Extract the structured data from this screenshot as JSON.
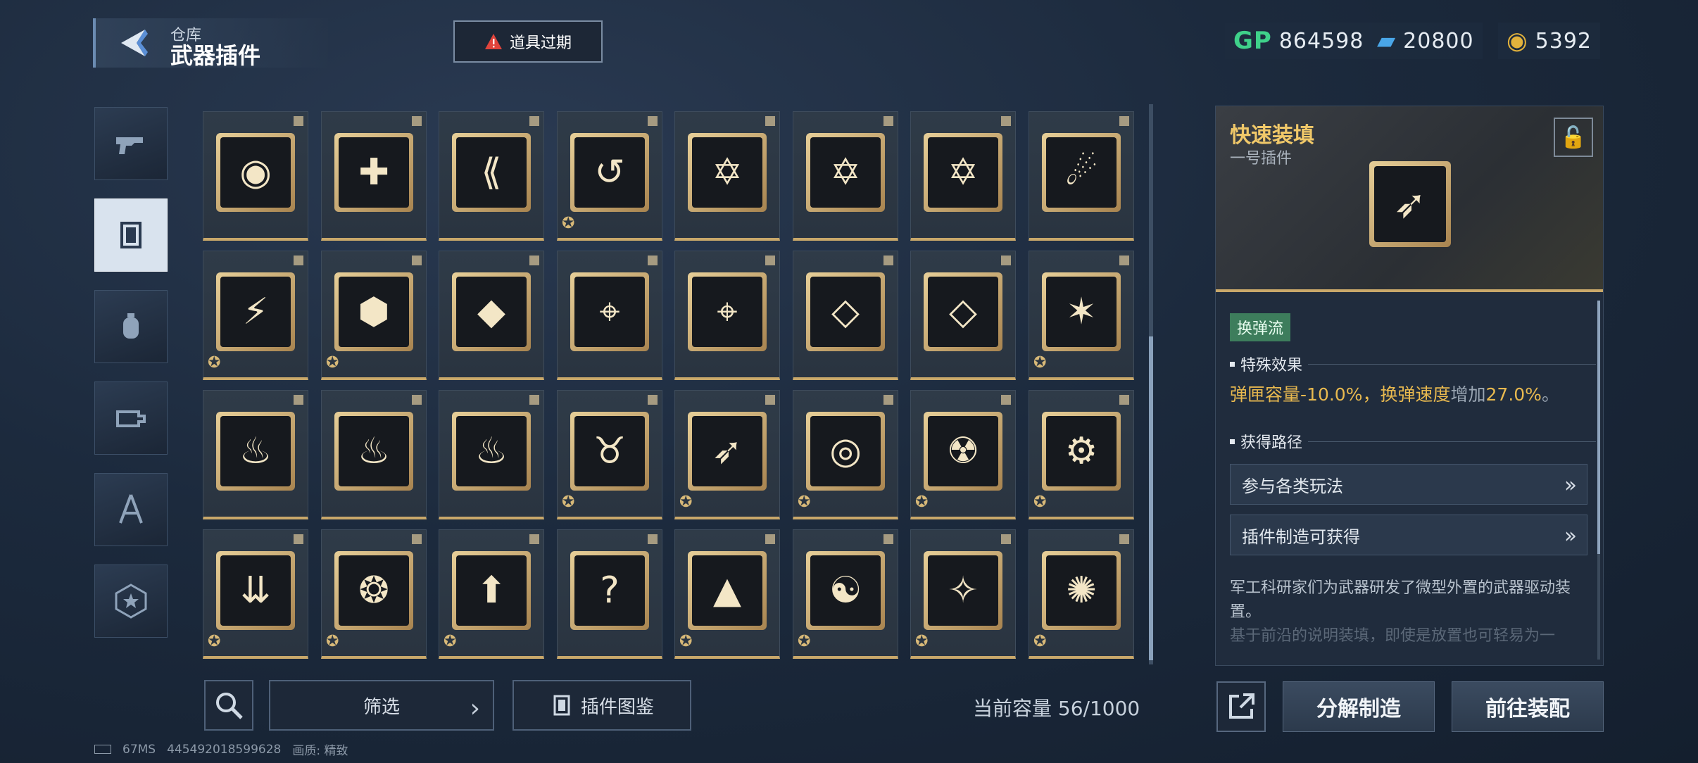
{
  "header": {
    "back_subtitle": "仓库",
    "back_title": "武器插件",
    "expire_label": "道具过期"
  },
  "currencies": [
    {
      "icon": "gp-icon",
      "symbol": "GP",
      "value": "864598",
      "color": "#3fd18a"
    },
    {
      "icon": "ticket-icon",
      "symbol": "▰",
      "value": "20800",
      "color": "#49a6e8"
    },
    {
      "icon": "coin-icon",
      "symbol": "◉",
      "value": "5392",
      "color": "#e2b23c"
    }
  ],
  "nav": [
    {
      "name": "nav-weapon",
      "icon": "gun-icon",
      "active": false
    },
    {
      "name": "nav-plugin",
      "icon": "plugin-card-icon",
      "active": true
    },
    {
      "name": "nav-grenade",
      "icon": "grenade-icon",
      "active": false
    },
    {
      "name": "nav-attachment",
      "icon": "attachment-icon",
      "active": false
    },
    {
      "name": "nav-skill",
      "icon": "compass-icon",
      "active": false
    },
    {
      "name": "nav-badge",
      "icon": "star-badge-icon",
      "active": false
    }
  ],
  "grid": {
    "rows": [
      [
        {
          "icon": "eye-icon",
          "glyph": "◉",
          "badge": ""
        },
        {
          "icon": "cross-target-icon",
          "glyph": "✚",
          "badge": ""
        },
        {
          "icon": "arrow-split-icon",
          "glyph": "⟪",
          "badge": ""
        },
        {
          "icon": "recycle-target-icon",
          "glyph": "↺",
          "badge": "✪"
        },
        {
          "icon": "hexagram-icon",
          "glyph": "✡",
          "badge": ""
        },
        {
          "icon": "hexagram-icon",
          "glyph": "✡",
          "badge": ""
        },
        {
          "icon": "hexagram-icon",
          "glyph": "✡",
          "badge": ""
        },
        {
          "icon": "comet-icon",
          "glyph": "☄",
          "badge": ""
        }
      ],
      [
        {
          "icon": "lightning-up-icon",
          "glyph": "⚡",
          "badge": "✪"
        },
        {
          "icon": "bullets-icon",
          "glyph": "⬢",
          "badge": "✪"
        },
        {
          "icon": "crystal-icon",
          "glyph": "◆",
          "badge": ""
        },
        {
          "icon": "crosshair-icon",
          "glyph": "⌖",
          "badge": ""
        },
        {
          "icon": "crosshair-icon",
          "glyph": "⌖",
          "badge": ""
        },
        {
          "icon": "diamond-clock-icon",
          "glyph": "◇",
          "badge": ""
        },
        {
          "icon": "diamond-clock-icon",
          "glyph": "◇",
          "badge": ""
        },
        {
          "icon": "star-burst-icon",
          "glyph": "✶",
          "badge": "✪"
        }
      ],
      [
        {
          "icon": "flame-icon",
          "glyph": "♨",
          "badge": ""
        },
        {
          "icon": "flame-icon",
          "glyph": "♨",
          "badge": ""
        },
        {
          "icon": "flame-icon",
          "glyph": "♨",
          "badge": ""
        },
        {
          "icon": "ox-head-icon",
          "glyph": "♉",
          "badge": "✪"
        },
        {
          "icon": "rocket-swirl-icon",
          "glyph": "➶",
          "badge": "✪"
        },
        {
          "icon": "ring-nodes-icon",
          "glyph": "◎",
          "badge": "✪"
        },
        {
          "icon": "bomb-icon",
          "glyph": "☢",
          "badge": "✪"
        },
        {
          "icon": "gear-up-icon",
          "glyph": "⚙",
          "badge": "✪"
        }
      ],
      [
        {
          "icon": "impact-down-icon",
          "glyph": "⇊",
          "badge": "✪"
        },
        {
          "icon": "medal-icon",
          "glyph": "❂",
          "badge": "✪"
        },
        {
          "icon": "shell-up-icon",
          "glyph": "⬆",
          "badge": "✪"
        },
        {
          "icon": "mystery-icon",
          "glyph": "?",
          "badge": ""
        },
        {
          "icon": "pyramid-icon",
          "glyph": "▲",
          "badge": "✪"
        },
        {
          "icon": "swirl-icon",
          "glyph": "☯",
          "badge": "✪"
        },
        {
          "icon": "claw-icon",
          "glyph": "✧",
          "badge": "✪"
        },
        {
          "icon": "shatter-icon",
          "glyph": "✺",
          "badge": "✪"
        }
      ]
    ]
  },
  "bottom": {
    "filter_label": "筛选",
    "atlas_label": "插件图鉴",
    "capacity_label": "当前容量",
    "capacity_value": "56/1000",
    "ping": "67MS",
    "device_id": "445492018599628",
    "quality_label": "画质:",
    "quality_value": "精致"
  },
  "detail": {
    "title": "快速装填",
    "subtitle": "一号插件",
    "tag": "换弹流",
    "effect_heading": "特殊效果",
    "effect": {
      "part1": "弹匣容量",
      "part2": "-10.0%",
      "part3": "，",
      "part4": "换弹速度",
      "part5": "增加",
      "part6": "27.0%",
      "part7": "。"
    },
    "route_heading": "获得路径",
    "routes": [
      "参与各类玩法",
      "插件制造可获得"
    ],
    "description": "军工科研家们为武器研发了微型外置的武器驱动装置。",
    "description_faded": "基于前沿的说明装填，即使是放置也可轻易为一",
    "accent_color": "#f0c869"
  },
  "actions": {
    "dismantle_label": "分解制造",
    "equip_label": "前往装配"
  }
}
